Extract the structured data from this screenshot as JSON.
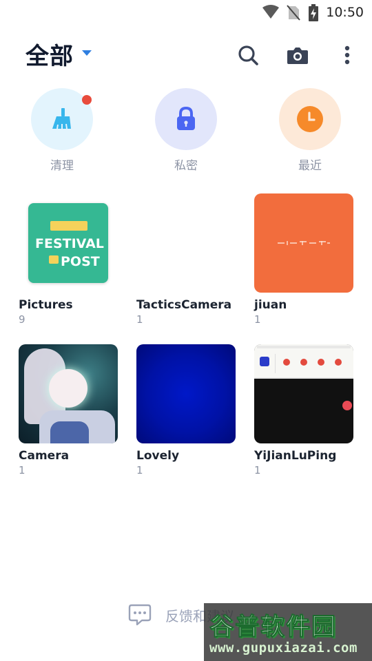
{
  "status_bar": {
    "time": "10:50"
  },
  "header": {
    "title": "全部",
    "accent": "#2f7fe0"
  },
  "quick_actions": [
    {
      "label": "清理",
      "icon": "broom-icon",
      "bg": "#e3f4fd",
      "fg": "#38b6ec",
      "badge": true
    },
    {
      "label": "私密",
      "icon": "lock-icon",
      "bg": "#e2e6fb",
      "fg": "#4b66f2",
      "badge": false
    },
    {
      "label": "最近",
      "icon": "clock-icon",
      "bg": "#fde9d8",
      "fg": "#f68a2a",
      "badge": false
    }
  ],
  "albums": [
    {
      "name": "Pictures",
      "count": "9",
      "thumb_text_1": "FESTIVAL",
      "thumb_text_2": "POST"
    },
    {
      "name": "TacticsCamera",
      "count": "1"
    },
    {
      "name": "jiuan",
      "count": "1"
    },
    {
      "name": "Camera",
      "count": "1"
    },
    {
      "name": "Lovely",
      "count": "1"
    },
    {
      "name": "YiJianLuPing",
      "count": "1"
    }
  ],
  "feedback": {
    "label": "反馈和建议"
  },
  "watermark": {
    "big": "谷普软件园",
    "small": "www.gupuxiazai.com"
  }
}
